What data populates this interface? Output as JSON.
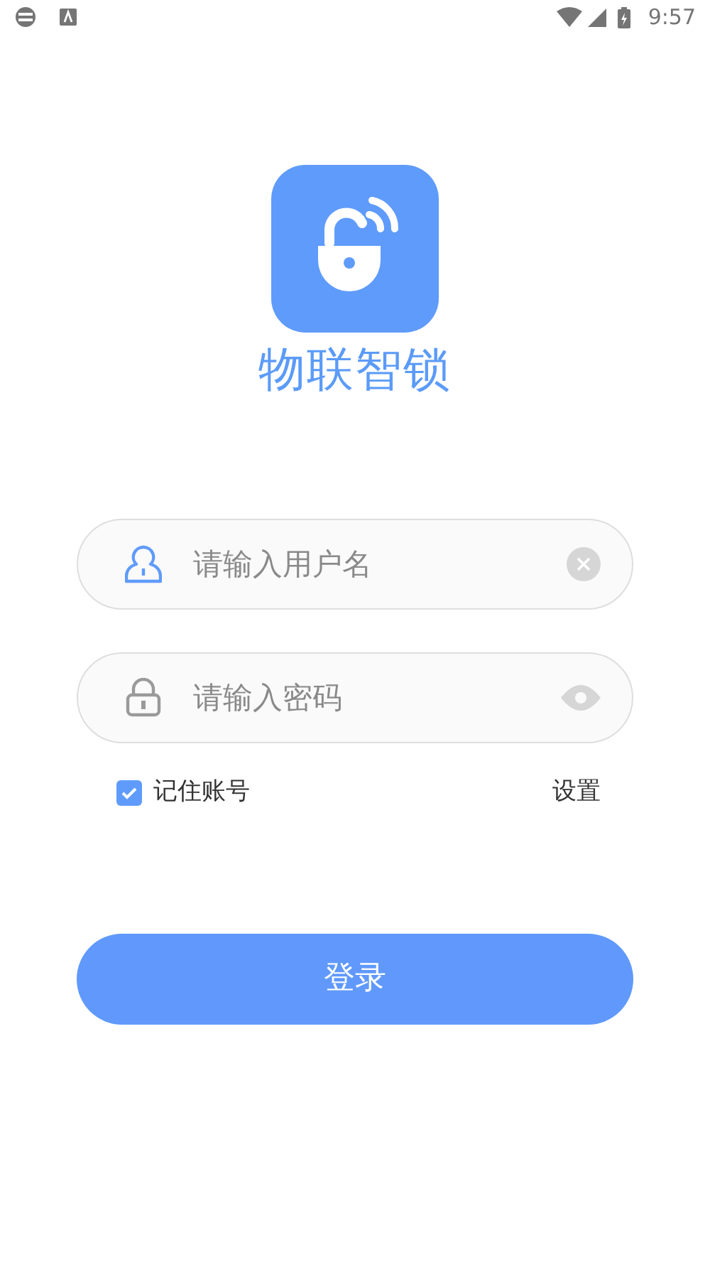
{
  "status_bar": {
    "time": "9:57"
  },
  "app": {
    "name": "物联智锁"
  },
  "fields": [
    {
      "kind": "username",
      "placeholder": "请输入用户名",
      "focused": true
    },
    {
      "kind": "password",
      "placeholder": "请输入密码",
      "focused": false
    }
  ],
  "remember": {
    "label": "记住账号",
    "checked": true
  },
  "settings_link": "设置",
  "login_button": "登录"
}
